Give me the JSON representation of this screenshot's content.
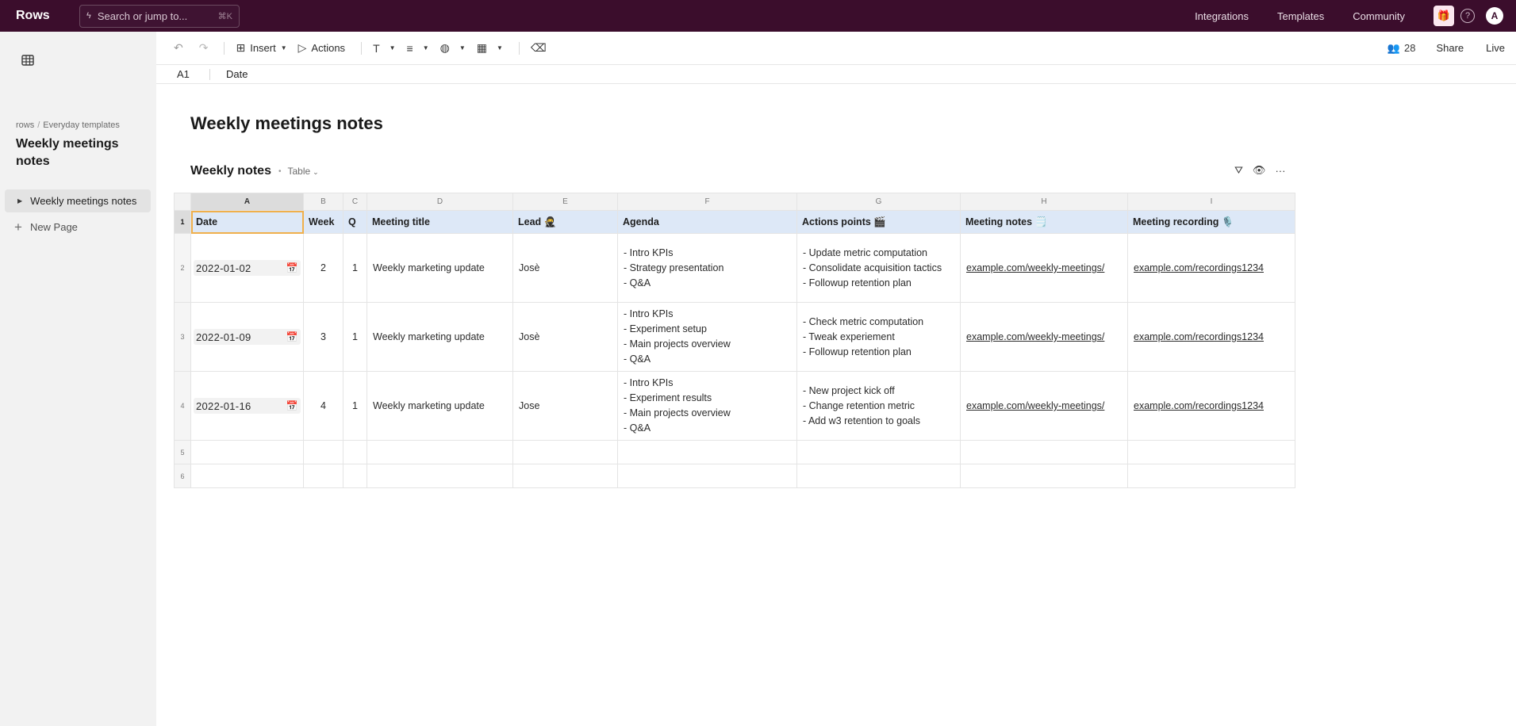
{
  "topbar": {
    "brand": "Rows",
    "search_placeholder": "Search or jump to...",
    "search_shortcut": "⌘K",
    "nav": [
      "Integrations",
      "Templates",
      "Community"
    ],
    "avatar_initial": "A"
  },
  "sidebar": {
    "breadcrumb": [
      "rows",
      "Everyday templates"
    ],
    "doc_title": "Weekly meetings notes",
    "pages": [
      {
        "label": "Weekly meetings notes"
      }
    ],
    "new_page_label": "New Page"
  },
  "toolbar": {
    "insert_label": "Insert",
    "actions_label": "Actions",
    "collaborators_count": "28",
    "share_label": "Share",
    "live_label": "Live"
  },
  "formula_bar": {
    "cell_ref": "A1",
    "value": "Date"
  },
  "page": {
    "title": "Weekly meetings notes"
  },
  "table": {
    "name": "Weekly notes",
    "view_type": "Table",
    "column_letters": [
      "A",
      "B",
      "C",
      "D",
      "E",
      "F",
      "G",
      "H",
      "I"
    ],
    "headers": [
      "Date",
      "Week",
      "Q",
      "Meeting title",
      "Lead 🥷",
      "Agenda",
      "Actions points 🎬",
      "Meeting notes 🗒️",
      "Meeting recording 🎙️"
    ],
    "row_numbers": [
      "1",
      "2",
      "3",
      "4",
      "5",
      "6"
    ],
    "rows": [
      {
        "date": "2022-01-02",
        "week": "2",
        "q": "1",
        "title": "Weekly marketing update",
        "lead": "Josè",
        "agenda": "- Intro KPIs\n- Strategy presentation\n- Q&A",
        "actions": "- Update metric computation\n- Consolidate acquisition tactics\n- Followup retention plan",
        "notes": "example.com/weekly-meetings/",
        "recording": "example.com/recordings1234"
      },
      {
        "date": "2022-01-09",
        "week": "3",
        "q": "1",
        "title": "Weekly marketing update",
        "lead": "Josè",
        "agenda": "- Intro KPIs\n- Experiment setup\n- Main projects overview\n- Q&A",
        "actions": "- Check metric computation\n- Tweak experiement\n- Followup retention plan",
        "notes": "example.com/weekly-meetings/",
        "recording": "example.com/recordings1234"
      },
      {
        "date": "2022-01-16",
        "week": "4",
        "q": "1",
        "title": "Weekly marketing update",
        "lead": "Jose",
        "agenda": "- Intro KPIs\n- Experiment results\n- Main projects overview\n- Q&A",
        "actions": "- New project kick off\n- Change retention metric\n- Add w3 retention to goals",
        "notes": "example.com/weekly-meetings/",
        "recording": "example.com/recordings1234"
      }
    ]
  },
  "colors": {
    "topbar_bg": "#3b0d2c",
    "header_row_bg": "#dde8f7",
    "active_cell_border": "#f0b04c",
    "sidebar_bg": "#f2f2f2"
  }
}
